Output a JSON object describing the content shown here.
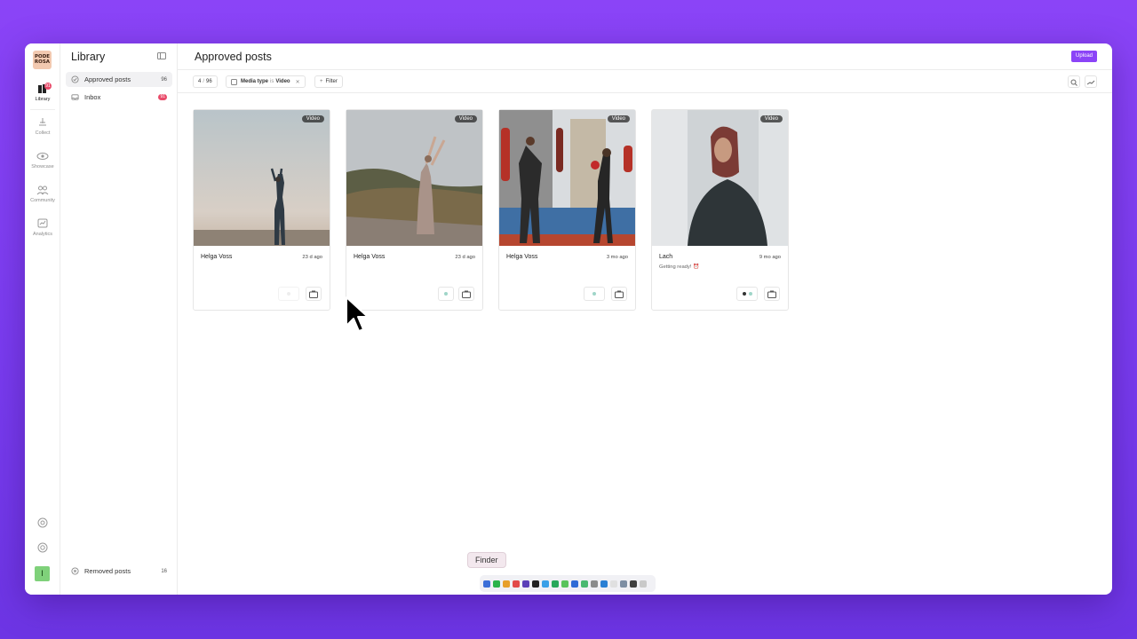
{
  "app": {
    "logo_text": "PODE ROSA",
    "rail": {
      "items": [
        {
          "label": "Library",
          "icon": "library-icon",
          "badge": "91"
        },
        {
          "label": "Collect",
          "icon": "collect-icon"
        },
        {
          "label": "Showcase",
          "icon": "eye-icon"
        },
        {
          "label": "Community",
          "icon": "community-icon"
        },
        {
          "label": "Analytics",
          "icon": "analytics-icon"
        }
      ],
      "settings_icon": "gear-icon",
      "help_icon": "lifebuoy-icon",
      "avatar_letter": "I"
    }
  },
  "library": {
    "title": "Library",
    "nav": [
      {
        "label": "Approved posts",
        "count": "96"
      },
      {
        "label": "Inbox",
        "count": "91"
      }
    ],
    "removed": {
      "label": "Removed posts",
      "count": "16"
    }
  },
  "main": {
    "title": "Approved posts",
    "upload_label": "Upload",
    "pager": {
      "current": "4",
      "sep": "/",
      "total": "96"
    },
    "filter_chip": {
      "field": "Media type",
      "op": "is",
      "value": "Video"
    },
    "add_filter_label": "Filter",
    "cards": [
      {
        "tag": "Video",
        "author": "Helga Voss",
        "time": "23 d ago",
        "caption": ""
      },
      {
        "tag": "Video",
        "author": "Helga Voss",
        "time": "23 d ago",
        "caption": ""
      },
      {
        "tag": "Video",
        "author": "Helga Voss",
        "time": "3 mo ago",
        "caption": ""
      },
      {
        "tag": "Video",
        "author": "Lach",
        "time": "9 mo ago",
        "caption": "Getting ready! ⏰"
      }
    ]
  },
  "dock": {
    "tooltip": "Finder"
  },
  "colors": {
    "accent": "#8b44f7",
    "badge": "#e94b6a",
    "background": "#7a3cf0"
  }
}
